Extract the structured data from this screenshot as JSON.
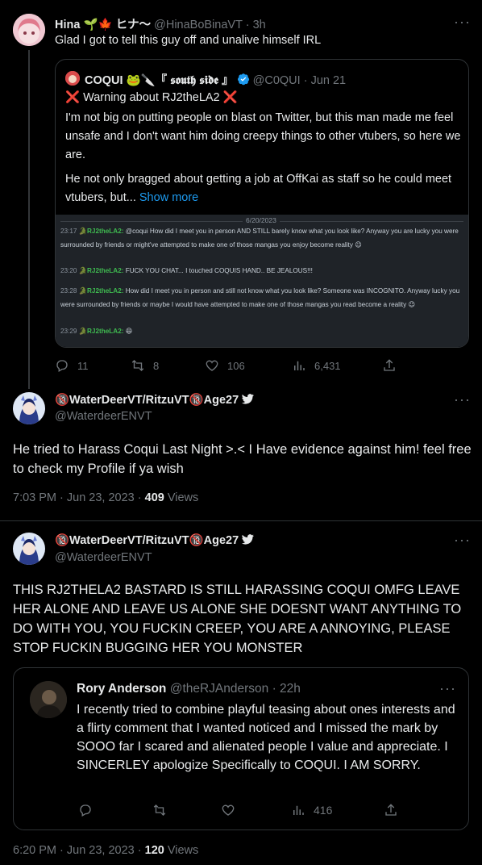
{
  "tweet1": {
    "name": "Hina 🌱🍁 ヒナ〜",
    "handle": "@HinaBoBinaVT",
    "time": "· 3h",
    "text": "Glad I got to tell this guy off and unalive himself IRL",
    "quote": {
      "name": "COQUI 🐸🔪『 𝖘𝖔𝖚𝖙𝖍 𝖘𝖎𝖉𝖊 』",
      "handle": "@C0QUI",
      "time": "· Jun 21",
      "line1": "❌ Warning about RJ2theLA2 ❌",
      "body1": "I'm not big on putting people on blast on Twitter, but this man made me feel unsafe and I don't want him doing creepy things to other vtubers, so here we are.",
      "body2": "He not only bragged about getting a job at OffKai as staff so he could meet vtubers, but...",
      "show_more": "Show more",
      "screenshot": {
        "date": "6/20/2023",
        "messages": [
          {
            "time": "23:17",
            "user": "RJ2theLA2:",
            "text": "@coqui How did I meet you in person AND STILL barely know what you look like? Anyway you are lucky you were surrounded by friends or might've attempted to make one of those mangas you enjoy become reality 😉"
          },
          {
            "time": "23:20",
            "user": "RJ2theLA2:",
            "text": "FUCK YOU CHAT... I touched COQUIS HAND.. BE JEALOUS!!!"
          },
          {
            "time": "23:28",
            "user": "RJ2theLA2:",
            "text": "How did I meet you in person and still not know what you look like? Someone was INCOGNITO. Anyway lucky you were surrounded by friends or maybe I would have attempted to make one of those mangas you read become a reality 😉"
          },
          {
            "time": "23:29",
            "user": "RJ2theLA2:",
            "text": "😆"
          }
        ]
      }
    },
    "actions": {
      "replies": "11",
      "retweets": "8",
      "likes": "106",
      "views": "6,431"
    }
  },
  "tweet2": {
    "name": "🔞WaterDeerVT/RitzuVT🔞Age27",
    "handle": "@WaterdeerENVT",
    "text": "He tried to Harass Coqui Last Night >.< I Have evidence against him! feel free to check my Profile if ya wish",
    "meta_time": "7:03 PM · Jun 23, 2023 ·",
    "meta_views": "409",
    "meta_views_label": "Views"
  },
  "tweet3": {
    "name": "🔞WaterDeerVT/RitzuVT🔞Age27",
    "handle": "@WaterdeerENVT",
    "text": "THIS RJ2THELA2 BASTARD IS STILL HARASSING COQUI OMFG LEAVE HER ALONE AND LEAVE US ALONE SHE DOESNT WANT ANYTHING TO DO WITH YOU, YOU FUCKIN CREEP, YOU ARE A ANNOYING, PLEASE STOP FUCKIN BUGGING HER YOU MONSTER",
    "quote": {
      "name": "Rory Anderson",
      "handle": "@theRJAnderson",
      "time": "· 22h",
      "text": "I recently tried to combine playful teasing about ones interests and a flirty comment that I wanted noticed and I missed the mark by SOOO far I scared and alienated people I value and appreciate. I SINCERLEY apologize Specifically to COQUI. I AM SORRY.",
      "views": "416"
    },
    "meta_time": "6:20 PM · Jun 23, 2023 ·",
    "meta_views": "120",
    "meta_views_label": "Views"
  },
  "colors": {
    "bg": "#000000",
    "text": "#e7e9ea",
    "muted": "#71767b",
    "link": "#1d9bf0",
    "border": "#2f3336"
  }
}
